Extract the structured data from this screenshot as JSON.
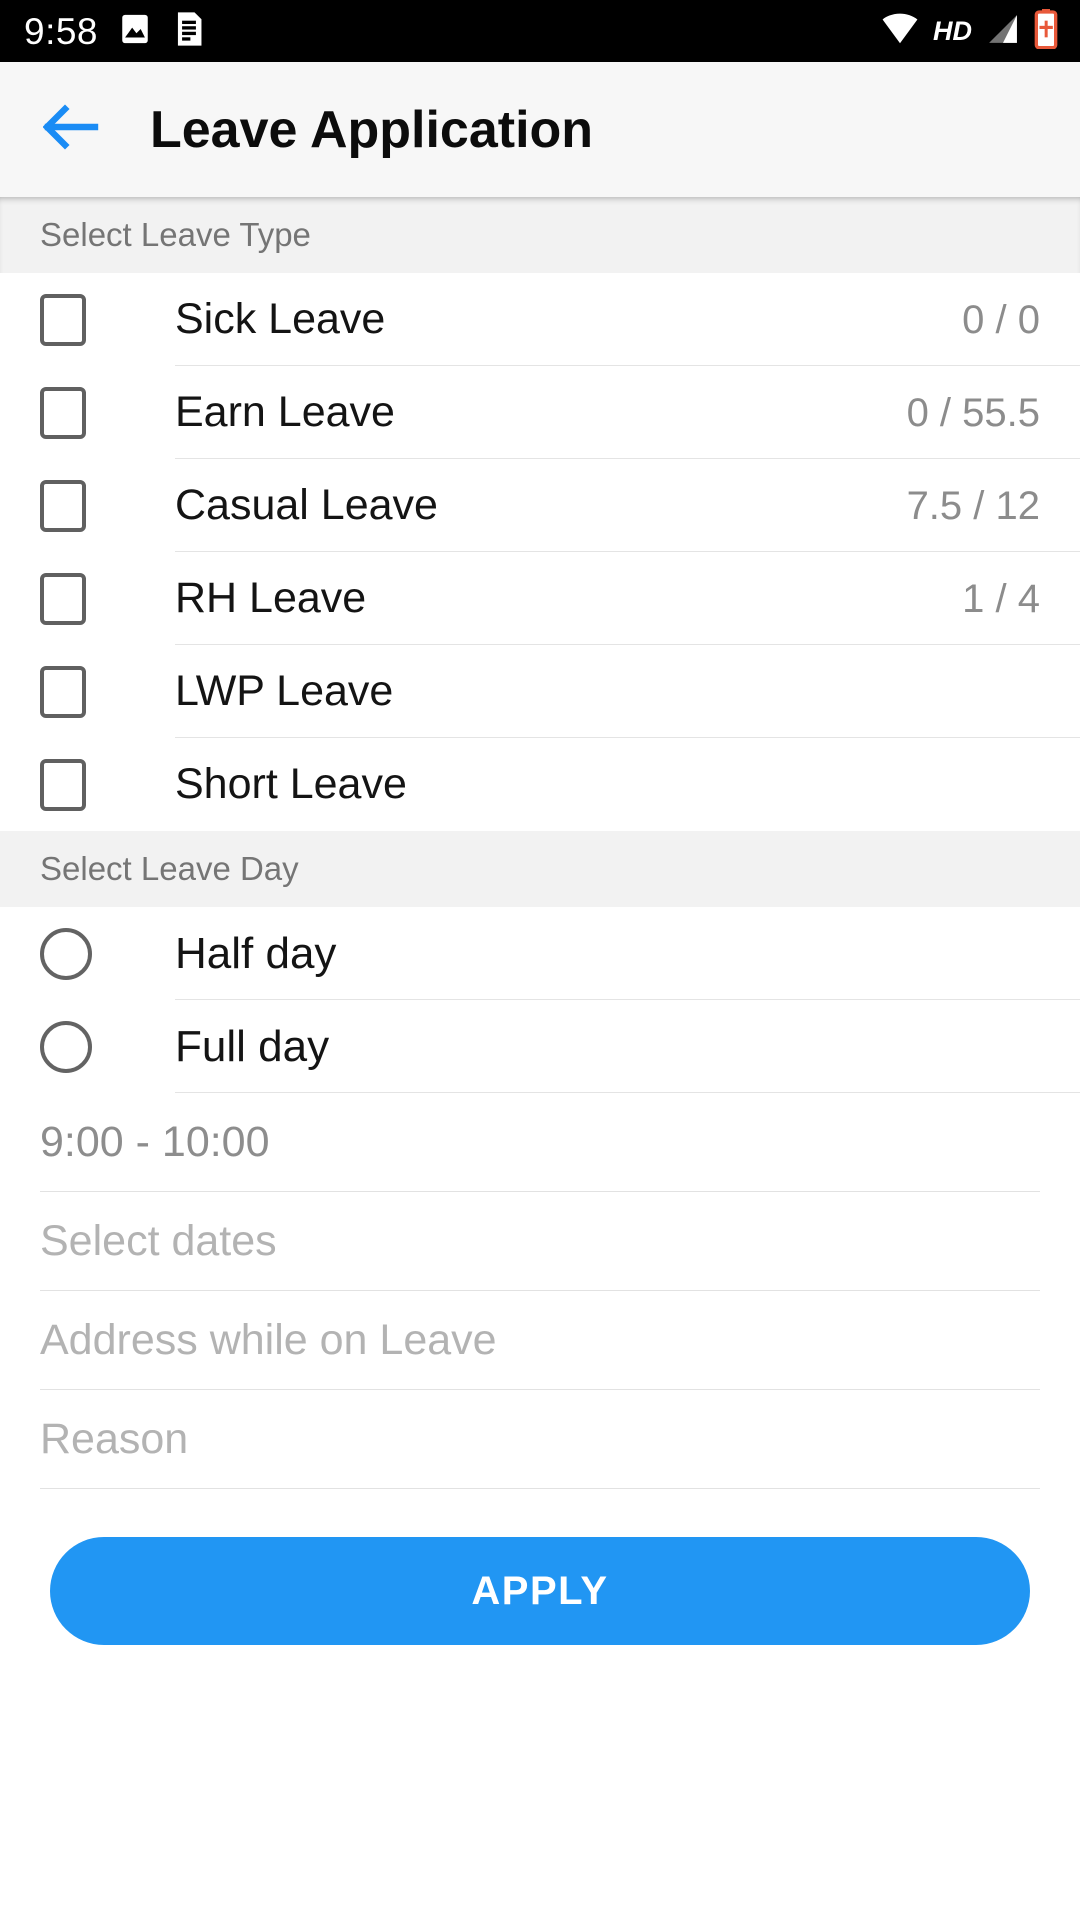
{
  "status_bar": {
    "time": "9:58",
    "left_icons": [
      "image-icon",
      "document-icon"
    ],
    "hd_label": "HD",
    "right_icons": [
      "wifi-icon",
      "signal-icon",
      "battery-charging-icon"
    ]
  },
  "appbar": {
    "back_icon": "back-arrow-icon",
    "title": "Leave Application",
    "accent_color": "#2196f3"
  },
  "leave_type_section": {
    "header": "Select Leave Type",
    "items": [
      {
        "label": "Sick Leave",
        "count": "0 / 0",
        "checked": false
      },
      {
        "label": "Earn Leave",
        "count": "0 / 55.5",
        "checked": false
      },
      {
        "label": "Casual Leave",
        "count": "7.5 / 12",
        "checked": false
      },
      {
        "label": "RH Leave",
        "count": "1 / 4",
        "checked": false
      },
      {
        "label": "LWP Leave",
        "count": "",
        "checked": false
      },
      {
        "label": "Short Leave",
        "count": "",
        "checked": false
      }
    ]
  },
  "leave_day_section": {
    "header": "Select Leave Day",
    "options": [
      {
        "label": "Half day",
        "selected": false
      },
      {
        "label": "Full day",
        "selected": false
      }
    ]
  },
  "fields": {
    "time_range": {
      "value": "9:00 - 10:00"
    },
    "dates": {
      "placeholder": "Select dates"
    },
    "address": {
      "placeholder": "Address while on Leave"
    },
    "reason": {
      "placeholder": "Reason"
    }
  },
  "apply_button": {
    "label": "APPLY",
    "color": "#2196f3"
  }
}
